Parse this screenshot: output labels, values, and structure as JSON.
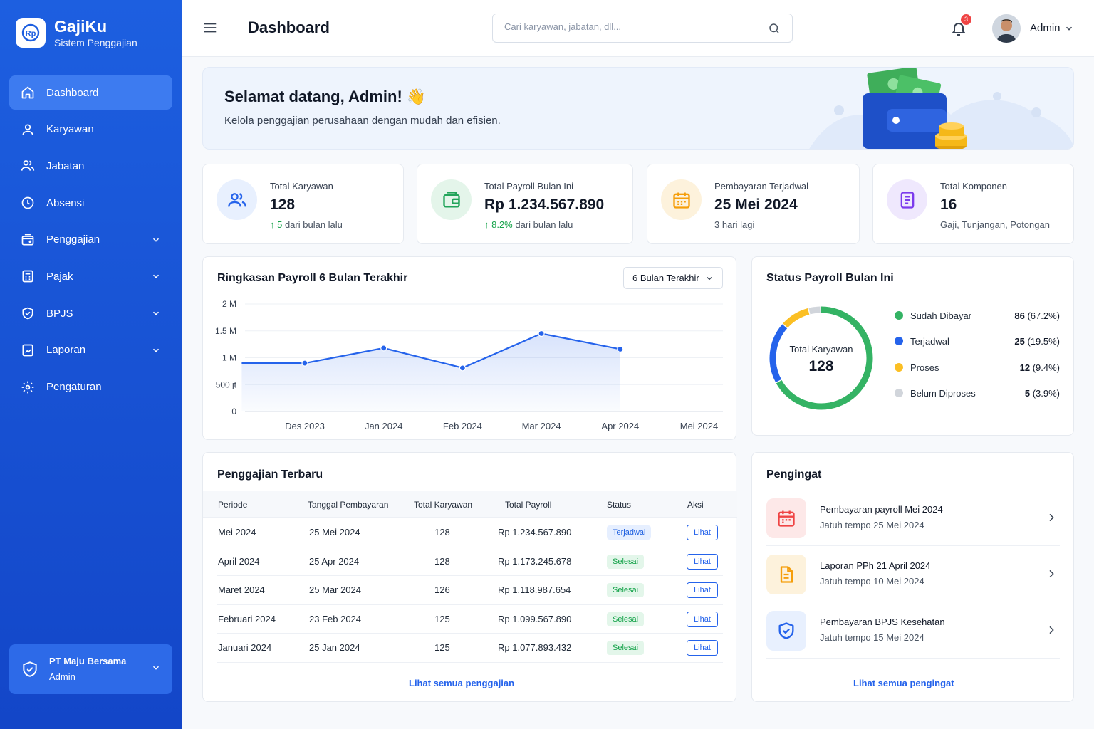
{
  "brand": {
    "name": "GajiKu",
    "subtitle": "Sistem Penggajian",
    "logo_text": "Rp"
  },
  "sidebar": {
    "items": [
      {
        "label": "Dashboard",
        "icon": "home-icon",
        "active": true
      },
      {
        "label": "Karyawan",
        "icon": "user-icon"
      },
      {
        "label": "Jabatan",
        "icon": "users-icon"
      },
      {
        "label": "Absensi",
        "icon": "clock-icon"
      },
      {
        "label": "Penggajian",
        "icon": "wallet-icon",
        "expandable": true
      },
      {
        "label": "Pajak",
        "icon": "calculator-icon",
        "expandable": true
      },
      {
        "label": "BPJS",
        "icon": "shield-icon",
        "expandable": true
      },
      {
        "label": "Laporan",
        "icon": "report-icon",
        "expandable": true
      },
      {
        "label": "Pengaturan",
        "icon": "gear-icon"
      }
    ],
    "company": {
      "name": "PT Maju Bersama",
      "role": "Admin"
    }
  },
  "header": {
    "title": "Dashboard",
    "search_placeholder": "Cari karyawan, jabatan, dll...",
    "notification_count": "3",
    "user_name": "Admin"
  },
  "welcome": {
    "title": "Selamat datang, Admin! 👋",
    "subtitle": "Kelola penggajian perusahaan dengan mudah dan efisien."
  },
  "stats": [
    {
      "label": "Total Karyawan",
      "value": "128",
      "delta": "↑ 5",
      "note": " dari bulan lalu",
      "color": "#2563eb",
      "bg": "#e8f0fe"
    },
    {
      "label": "Total Payroll Bulan Ini",
      "value": "Rp 1.234.567.890",
      "delta": "↑ 8.2%",
      "note": " dari bulan lalu",
      "color": "#22a45a",
      "bg": "#e4f5ea"
    },
    {
      "label": "Pembayaran Terjadwal",
      "value": "25 Mei 2024",
      "delta": "",
      "note": "3 hari lagi",
      "color": "#f59e0b",
      "bg": "#fdf2dc"
    },
    {
      "label": "Total Komponen",
      "value": "16",
      "delta": "",
      "note": "Gaji, Tunjangan, Potongan",
      "color": "#7c3aed",
      "bg": "#efe8fd"
    }
  ],
  "payroll_chart": {
    "title": "Ringkasan Payroll 6 Bulan Terakhir",
    "range_select": "6 Bulan Terakhir",
    "chart_data": {
      "type": "area",
      "categories": [
        "Des 2023",
        "Jan 2024",
        "Feb 2024",
        "Mar 2024",
        "Apr 2024",
        "Mei 2024"
      ],
      "y_tick_labels": [
        "0",
        "500 jt",
        "1 M",
        "1.5 M",
        "2 M"
      ],
      "y_ticks": [
        0,
        500,
        1000,
        1500,
        2000
      ],
      "ylim": [
        0,
        2000
      ],
      "y_unit": "jt",
      "x": [
        -0.8,
        0,
        1,
        2,
        3,
        4
      ],
      "values": [
        900,
        900,
        1180,
        810,
        1450,
        1160
      ],
      "marker_from_index": 1,
      "color": "#2563eb",
      "grid": true
    }
  },
  "status_chart": {
    "title": "Status Payroll Bulan Ini",
    "center_label": "Total Karyawan",
    "center_value": "128",
    "chart_data": {
      "type": "pie",
      "categories": [
        "Sudah Dibayar",
        "Terjadwal",
        "Proses",
        "Belum Diproses"
      ],
      "values": [
        86,
        25,
        12,
        5
      ],
      "labels": [
        "86 (67.2%)",
        "25 (19.5%)",
        "12 (9.4%)",
        "5 (3.9%)"
      ],
      "colors": [
        "#34b364",
        "#2563eb",
        "#fbbf24",
        "#d1d5db"
      ]
    }
  },
  "recent_payroll": {
    "title": "Penggajian Terbaru",
    "columns": [
      "Periode",
      "Tanggal Pembayaran",
      "Total Karyawan",
      "Total Payroll",
      "Status",
      "Aksi"
    ],
    "rows": [
      {
        "period": "Mei 2024",
        "date": "25 Mei 2024",
        "employees": "128",
        "total": "Rp 1.234.567.890",
        "status": "Terjadwal",
        "status_type": "sched",
        "action": "Lihat"
      },
      {
        "period": "April 2024",
        "date": "25 Apr 2024",
        "employees": "128",
        "total": "Rp 1.173.245.678",
        "status": "Selesai",
        "status_type": "done",
        "action": "Lihat"
      },
      {
        "period": "Maret 2024",
        "date": "25 Mar 2024",
        "employees": "126",
        "total": "Rp 1.118.987.654",
        "status": "Selesai",
        "status_type": "done",
        "action": "Lihat"
      },
      {
        "period": "Februari 2024",
        "date": "23 Feb 2024",
        "employees": "125",
        "total": "Rp 1.099.567.890",
        "status": "Selesai",
        "status_type": "done",
        "action": "Lihat"
      },
      {
        "period": "Januari 2024",
        "date": "25 Jan 2024",
        "employees": "125",
        "total": "Rp 1.077.893.432",
        "status": "Selesai",
        "status_type": "done",
        "action": "Lihat"
      }
    ],
    "view_all": "Lihat semua penggajian"
  },
  "reminders": {
    "title": "Pengingat",
    "items": [
      {
        "title": "Pembayaran payroll Mei 2024",
        "due": "Jatuh tempo 25 Mei 2024",
        "icon": "calendar-icon",
        "color": "#ef4444",
        "bg": "#fde8e8"
      },
      {
        "title": "Laporan PPh 21 April 2024",
        "due": "Jatuh tempo 10 Mei 2024",
        "icon": "document-icon",
        "color": "#f59e0b",
        "bg": "#fdf2dc"
      },
      {
        "title": "Pembayaran BPJS Kesehatan",
        "due": "Jatuh tempo 15 Mei 2024",
        "icon": "shield-check-icon",
        "color": "#2563eb",
        "bg": "#e8f0fe"
      }
    ],
    "view_all": "Lihat semua pengingat"
  }
}
